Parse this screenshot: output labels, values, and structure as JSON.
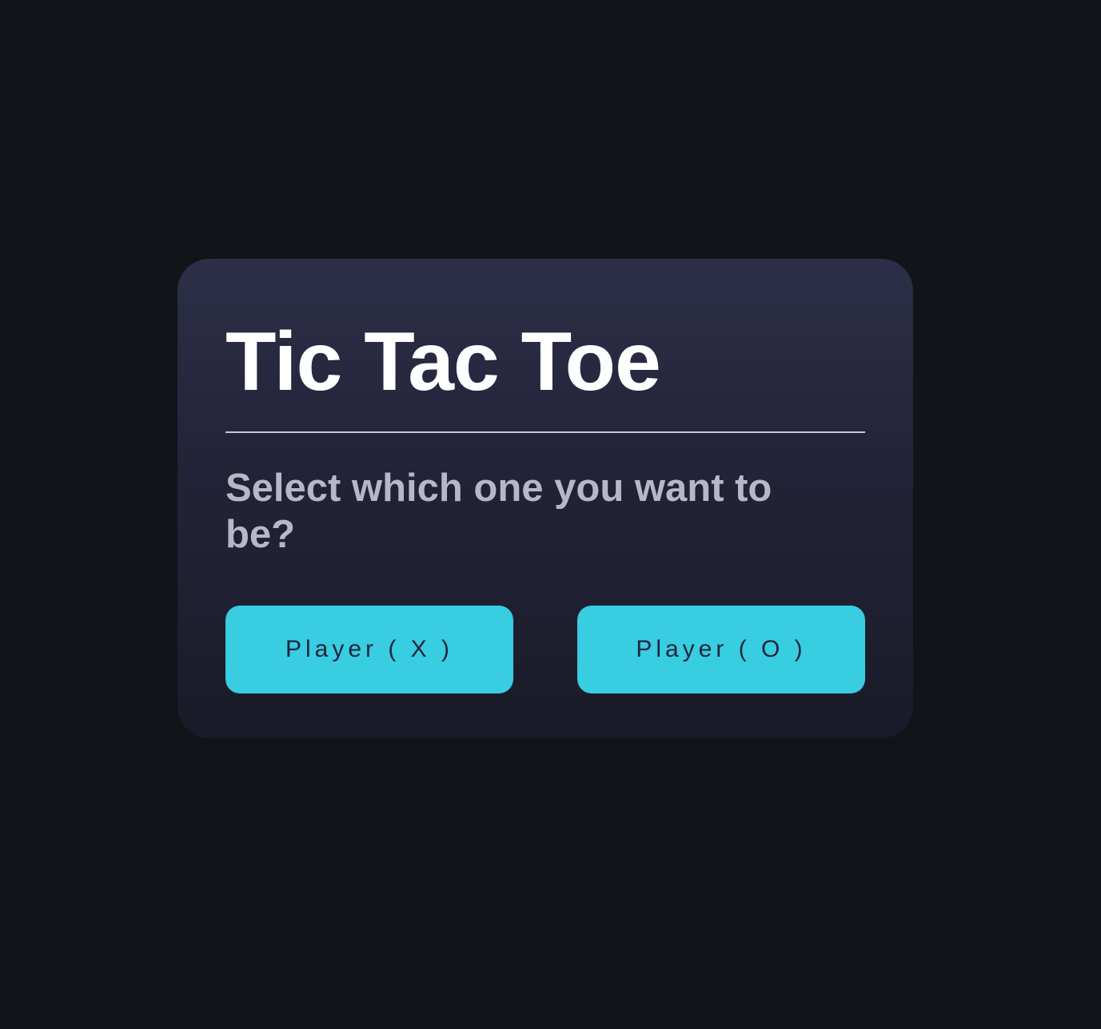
{
  "dialog": {
    "title": "Tic Tac Toe",
    "prompt": "Select which one you want to be?"
  },
  "buttons": {
    "player_x": "Player ( X )",
    "player_o": "Player ( O )"
  },
  "colors": {
    "background": "#13141a",
    "card_top": "#2d2f48",
    "card_bottom": "#1a1b28",
    "title": "#ffffff",
    "prompt": "#b7b7c8",
    "button": "#38cde0",
    "button_text": "#1f2540"
  }
}
